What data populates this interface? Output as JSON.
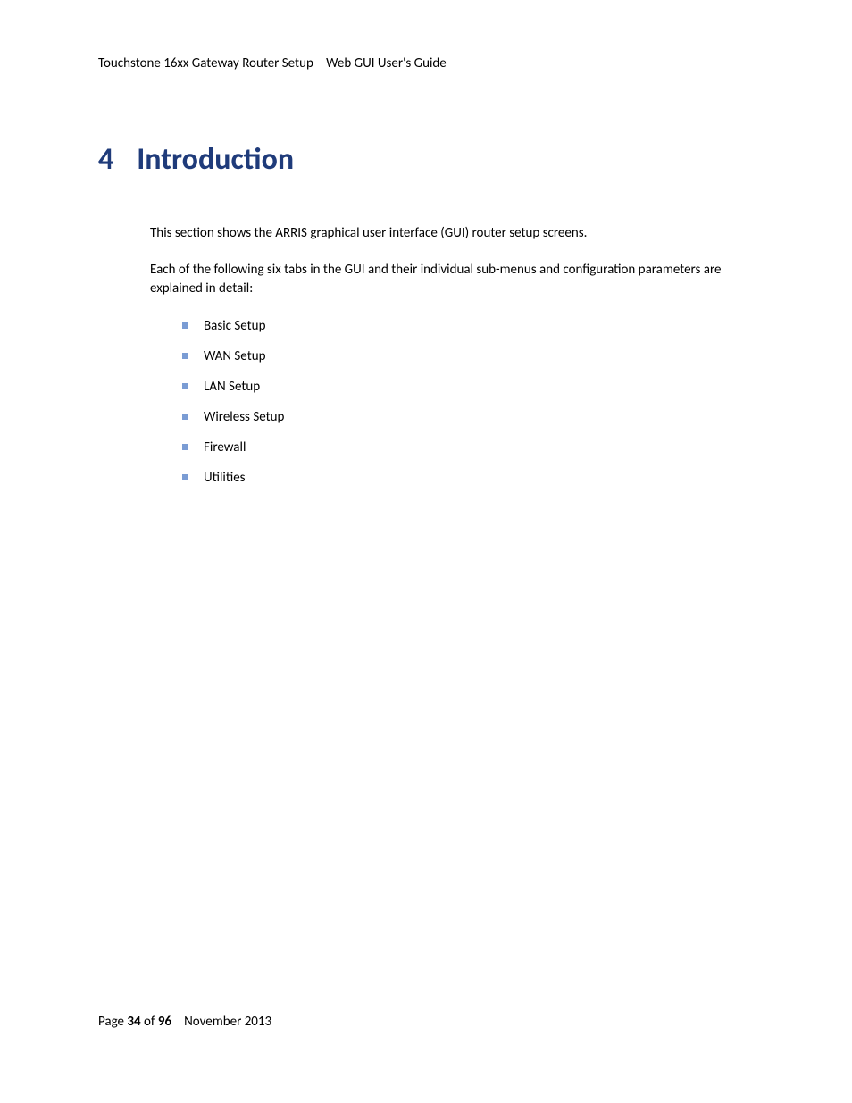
{
  "header": {
    "title": "Touchstone 16xx Gateway Router Setup – Web GUI User's Guide"
  },
  "chapter": {
    "number": "4",
    "title": "Introduction"
  },
  "body": {
    "paragraph1": "This section shows the ARRIS graphical user interface (GUI) router setup screens.",
    "paragraph2": "Each of the following six tabs in the GUI and their individual sub-menus and configuration parameters are explained in detail:",
    "bullets": [
      "Basic Setup",
      "WAN Setup",
      "LAN Setup",
      "Wireless Setup",
      "Firewall",
      "Utilities"
    ]
  },
  "footer": {
    "page_label": "Page ",
    "page_current": "34",
    "page_of": " of ",
    "page_total": "96",
    "date": "November 2013"
  }
}
